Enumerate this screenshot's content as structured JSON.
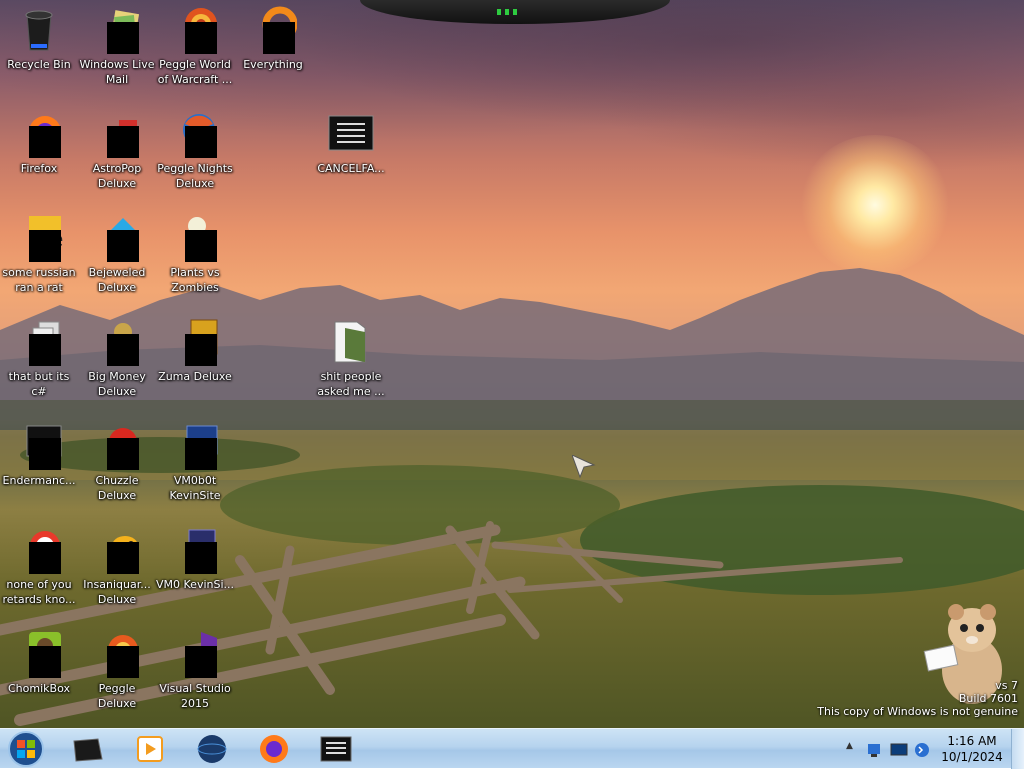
{
  "desktop": {
    "icons": [
      {
        "label": "Recycle Bin"
      },
      {
        "label": "Windows Live Mail"
      },
      {
        "label": "Peggle World of Warcraft ..."
      },
      {
        "label": "Everything"
      },
      {
        "label": "Firefox"
      },
      {
        "label": "AstroPop Deluxe"
      },
      {
        "label": "Peggle Nights Deluxe"
      },
      {
        "label": "CANCELFA..."
      },
      {
        "label": "some russian ran a rat"
      },
      {
        "label": "Bejeweled Deluxe"
      },
      {
        "label": "Plants vs Zombies"
      },
      {
        "label": "that but its c#"
      },
      {
        "label": "Big Money Deluxe"
      },
      {
        "label": "Zuma Deluxe"
      },
      {
        "label": "shit people asked me ..."
      },
      {
        "label": "Endermanc..."
      },
      {
        "label": "Chuzzle Deluxe"
      },
      {
        "label": "VM0b0t KevinSite"
      },
      {
        "label": "none of you retards kno..."
      },
      {
        "label": "Insaniquar... Deluxe"
      },
      {
        "label": "VM0 KevinSi..."
      },
      {
        "label": "ChomikBox"
      },
      {
        "label": "Peggle Deluxe"
      },
      {
        "label": "Visual Studio 2015"
      }
    ]
  },
  "watermark": {
    "line1": "vs 7",
    "line2": "Build 7601",
    "line3": "This copy of Windows is not genuine"
  },
  "taskbar": {
    "start_icon": "windows-start-orb",
    "pinned": [
      {
        "name": "virtual-machine",
        "icon": "black-box-icon"
      },
      {
        "name": "media-player",
        "icon": "media-player-icon"
      },
      {
        "name": "globe-app",
        "icon": "globe-icon"
      },
      {
        "name": "firefox",
        "icon": "firefox-icon"
      },
      {
        "name": "console-app",
        "icon": "console-icon"
      }
    ],
    "tray": {
      "show_hidden_icon": "▲",
      "time": "1:16 AM",
      "date": "10/1/2024"
    }
  },
  "colors": {
    "taskbar": "#b6d3ee",
    "label_text": "#ffffff",
    "redaction": "#000000"
  }
}
